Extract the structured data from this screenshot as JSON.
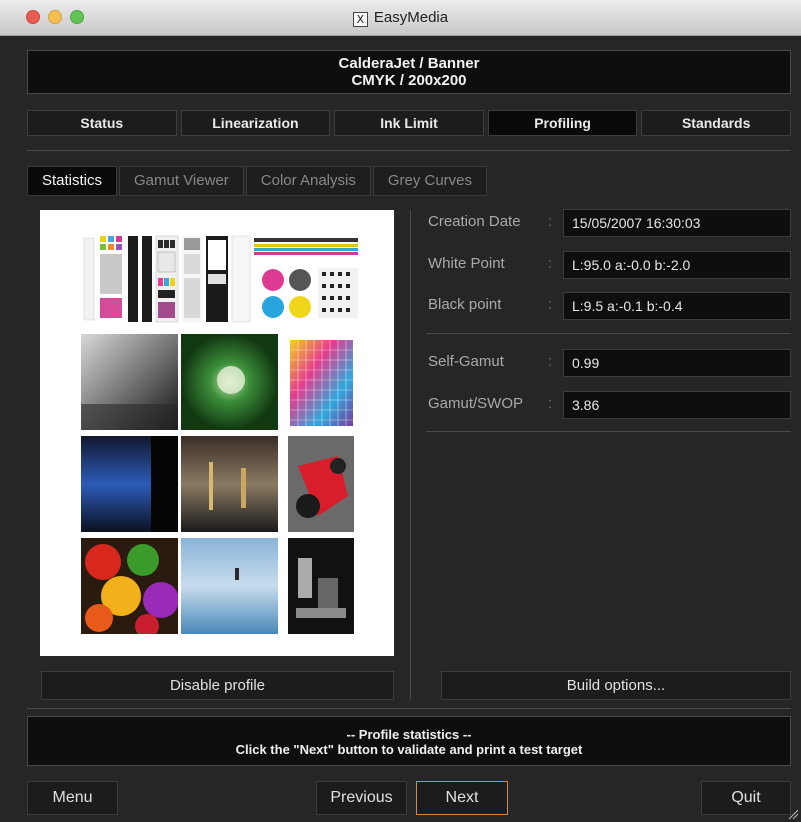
{
  "window": {
    "title": "EasyMedia"
  },
  "header": {
    "line1": "CalderaJet / Banner",
    "line2": "CMYK / 200x200"
  },
  "main_tabs": [
    {
      "label": "Status"
    },
    {
      "label": "Linearization"
    },
    {
      "label": "Ink Limit"
    },
    {
      "label": "Profiling",
      "active": true
    },
    {
      "label": "Standards"
    }
  ],
  "sub_tabs": [
    {
      "label": "Statistics",
      "active": true
    },
    {
      "label": "Gamut Viewer"
    },
    {
      "label": "Color Analysis"
    },
    {
      "label": "Grey Curves"
    }
  ],
  "statistics": {
    "creation_date": {
      "label": "Creation Date",
      "separator": ":",
      "value": "15/05/2007 16:30:03"
    },
    "white_point": {
      "label": "White Point",
      "separator": ":",
      "value": "L:95.0 a:-0.0 b:-2.0"
    },
    "black_point": {
      "label": "Black point",
      "separator": ":",
      "value": "L:9.5 a:-0.1 b:-0.4"
    },
    "self_gamut": {
      "label": "Self-Gamut",
      "separator": ":",
      "value": "0.99"
    },
    "gamut_swop": {
      "label": "Gamut/SWOP",
      "separator": ":",
      "value": "3.86"
    }
  },
  "buttons": {
    "disable_profile": "Disable profile",
    "build_options": "Build options...",
    "menu": "Menu",
    "previous": "Previous",
    "next": "Next",
    "quit": "Quit"
  },
  "status": {
    "line1": "-- Profile statistics --",
    "line2": "Click the \"Next\" button to validate and print a test target"
  },
  "icons": {
    "window_icon": "x-window-icon",
    "close": "close-circle-icon",
    "minimize": "minimize-circle-icon",
    "maximize": "maximize-circle-icon",
    "resize": "resize-grip-icon"
  },
  "colors": {
    "accent": "#d48a3a",
    "background": "#262626",
    "field": "#0e0e0e"
  }
}
